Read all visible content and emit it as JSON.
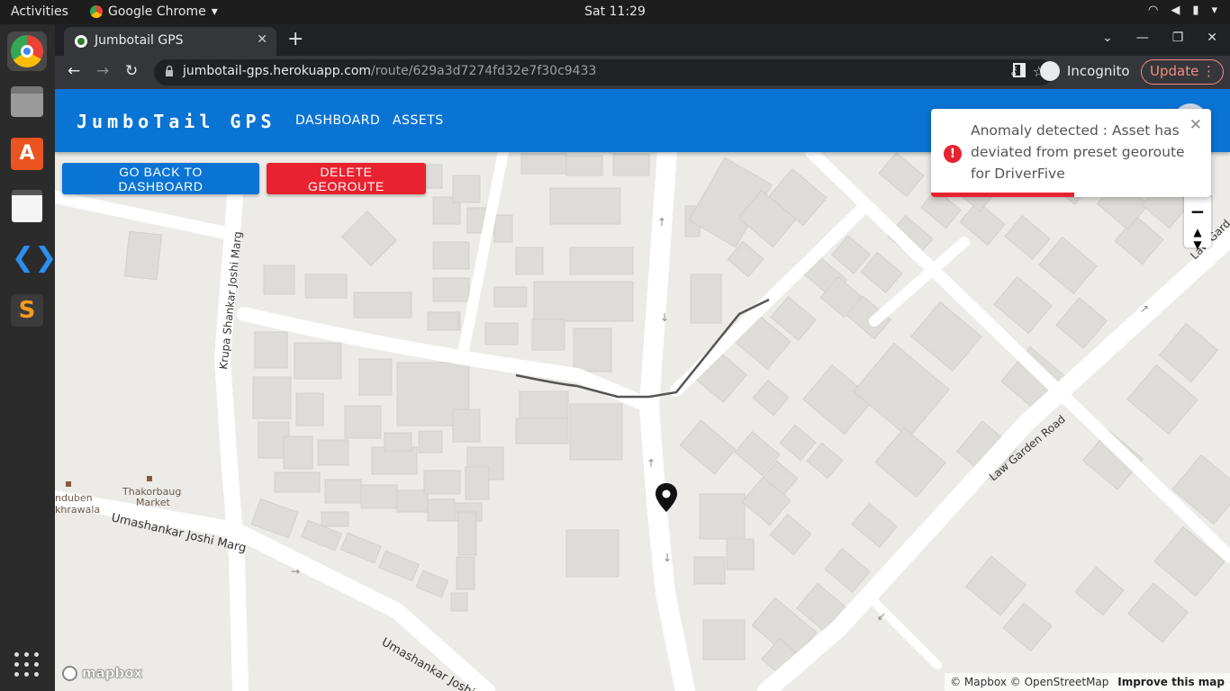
{
  "os": {
    "activities": "Activities",
    "app_name": "Google Chrome",
    "clock": "Sat 11:29"
  },
  "browser": {
    "tab_title": "Jumbotail GPS",
    "url_host": "jumbotail-gps.herokuapp.com",
    "url_path": "/route/629a3d7274fd32e7f30c9433",
    "incognito_label": "Incognito",
    "update_label": "Update"
  },
  "app": {
    "brand": "JumboTail GPS",
    "nav": [
      "DASHBOARD",
      "ASSETS"
    ],
    "back_button": "GO BACK TO DASHBOARD",
    "delete_button": "DELETE GEOROUTE"
  },
  "toast": {
    "message": "Anomaly detected : Asset has deviated from preset georoute for DriverFive",
    "progress": 0.51,
    "accent_color": "#e8222f"
  },
  "map": {
    "labels": {
      "krupa": "Krupa Shankar Joshi Marg",
      "umashankar1": "Umashankar Joshi Marg",
      "umashankar2": "Umashankar Joshi",
      "lawgarden1": "Law Garden Road",
      "lawgarden2": "Law Gard",
      "thakorbaug1": "Thakorbaug",
      "thakorbaug2": "Market",
      "induben1": "nduben",
      "induben2": "khrawala"
    },
    "mapbox_logo": "mapbox",
    "attribution": "© Mapbox © OpenStreetMap",
    "improve": "Improve this map"
  },
  "colors": {
    "appbar": "#0a74d4",
    "danger": "#e8222f",
    "map_bg": "#ecebe8",
    "building": "#dedcd8"
  }
}
